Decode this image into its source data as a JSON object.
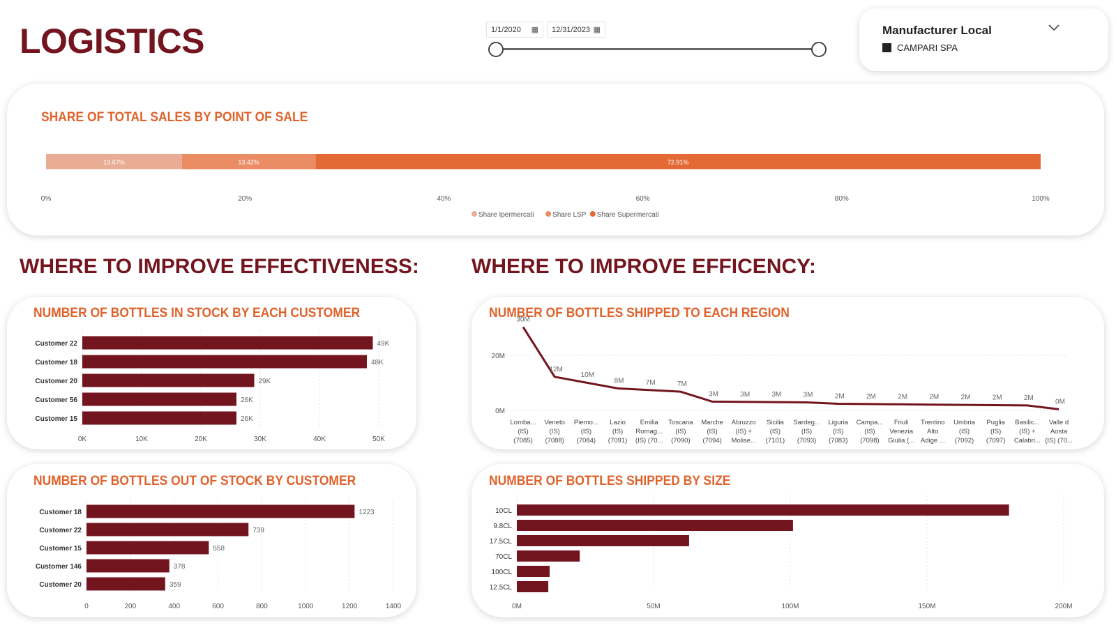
{
  "header": {
    "title": "LOGISTICS",
    "date_start": "1/1/2020",
    "date_end": "12/31/2023",
    "filter": {
      "title": "Manufacturer Local",
      "selected_item": "CAMPARI SPA"
    }
  },
  "colors": {
    "brand": "#73151f",
    "accent": "#e0622c",
    "bar": "#73151f",
    "share_1": "#e8ad94",
    "share_2": "#ea8d64",
    "share_3": "#e46a35"
  },
  "sections": {
    "effectiveness": "WHERE TO IMPROVE EFFECTIVENESS:",
    "efficiency": "WHERE TO IMPROVE EFFICENCY:"
  },
  "chart_data": [
    {
      "id": "share",
      "type": "bar",
      "orientation": "horizontal-stacked",
      "title": "SHARE OF TOTAL SALES BY POINT OF SALE",
      "series": [
        {
          "name": "Share Ipermercati",
          "values": [
            13.67
          ],
          "label": "13.67%"
        },
        {
          "name": "Share LSP",
          "values": [
            13.42
          ],
          "label": "13.42%"
        },
        {
          "name": "Share Supermercati",
          "values": [
            72.91
          ],
          "label": "72.91%"
        }
      ],
      "xlim": [
        0,
        100
      ],
      "xticks": [
        "0%",
        "20%",
        "40%",
        "60%",
        "80%",
        "100%"
      ],
      "legend": "bottom-center"
    },
    {
      "id": "instock",
      "type": "bar",
      "orientation": "horizontal",
      "title": "NUMBER OF BOTTLES IN STOCK BY EACH CUSTOMER",
      "categories": [
        "Customer 22",
        "Customer 18",
        "Customer 20",
        "Customer 56",
        "Customer 15"
      ],
      "values": [
        49000,
        48000,
        29000,
        26000,
        26000
      ],
      "labels": [
        "49K",
        "48K",
        "29K",
        "26K",
        "26K"
      ],
      "xlim": [
        0,
        50000
      ],
      "xticks": [
        0,
        10000,
        20000,
        30000,
        40000,
        50000
      ],
      "xtick_labels": [
        "0K",
        "10K",
        "20K",
        "30K",
        "40K",
        "50K"
      ]
    },
    {
      "id": "outstock",
      "type": "bar",
      "orientation": "horizontal",
      "title": "NUMBER OF BOTTLES OUT OF STOCK BY CUSTOMER",
      "categories": [
        "Customer 18",
        "Customer 22",
        "Customer 15",
        "Customer 146",
        "Customer 20"
      ],
      "values": [
        1223,
        739,
        558,
        378,
        359
      ],
      "labels": [
        "1223",
        "739",
        "558",
        "378",
        "359"
      ],
      "xlim": [
        0,
        1400
      ],
      "xticks": [
        0,
        200,
        400,
        600,
        800,
        1000,
        1200,
        1400
      ],
      "xtick_labels": [
        "0",
        "200",
        "400",
        "600",
        "800",
        "1000",
        "1200",
        "1400"
      ]
    },
    {
      "id": "region",
      "type": "line",
      "title": "NUMBER OF BOTTLES SHIPPED TO EACH REGION",
      "categories": [
        [
          "Lomba...",
          "(IS)",
          "(7085)"
        ],
        [
          "Veneto",
          "(IS)",
          "(7088)"
        ],
        [
          "Piemo...",
          "(IS)",
          "(7084)"
        ],
        [
          "Lazio",
          "(IS)",
          "(7091)"
        ],
        [
          "Emilia",
          "Romag...",
          "(IS) (70..."
        ],
        [
          "Toscana",
          "(IS)",
          "(7090)"
        ],
        [
          "Marche",
          "(IS)",
          "(7094)"
        ],
        [
          "Abruzzo",
          "(IS) +",
          "Molise..."
        ],
        [
          "Sicilia",
          "(IS)",
          "(7101)"
        ],
        [
          "Sardeg...",
          "(IS)",
          "(7093)"
        ],
        [
          "Liguria",
          "(IS)",
          "(7083)"
        ],
        [
          "Campa...",
          "(IS)",
          "(7098)"
        ],
        [
          "Friuli",
          "Venezia",
          "Giulia (..."
        ],
        [
          "Trentino",
          "Alto",
          "Adige ..."
        ],
        [
          "Umbria",
          "(IS)",
          "(7092)"
        ],
        [
          "Puglia",
          "(IS)",
          "(7097)"
        ],
        [
          "Basilic...",
          "(IS) +",
          "Calabri..."
        ],
        [
          "Valle d",
          "Aosta",
          "(IS) (70..."
        ]
      ],
      "values": [
        30.3,
        12.2,
        10.1,
        8.0,
        7.4,
        6.8,
        3.2,
        3.1,
        3.0,
        2.9,
        2.4,
        2.3,
        2.2,
        2.1,
        2.0,
        1.9,
        1.8,
        0.4
      ],
      "labels": [
        "30M",
        "12M",
        "10M",
        "8M",
        "7M",
        "7M",
        "3M",
        "3M",
        "3M",
        "3M",
        "2M",
        "2M",
        "2M",
        "2M",
        "2M",
        "2M",
        "2M",
        "0M"
      ],
      "ylim": [
        0,
        30
      ],
      "yticks": [
        0,
        20
      ],
      "ytick_labels": [
        "0M",
        "20M"
      ]
    },
    {
      "id": "size",
      "type": "bar",
      "orientation": "horizontal",
      "title": "NUMBER OF BOTTLES SHIPPED BY SIZE",
      "categories": [
        "10CL",
        "9.8CL",
        "17.5CL",
        "70CL",
        "100CL",
        "12.5CL"
      ],
      "values": [
        180,
        101,
        63,
        23,
        12,
        11.5
      ],
      "xlim": [
        0,
        200
      ],
      "xticks": [
        0,
        50,
        100,
        150,
        200
      ],
      "xtick_labels": [
        "0M",
        "50M",
        "100M",
        "150M",
        "200M"
      ]
    }
  ]
}
